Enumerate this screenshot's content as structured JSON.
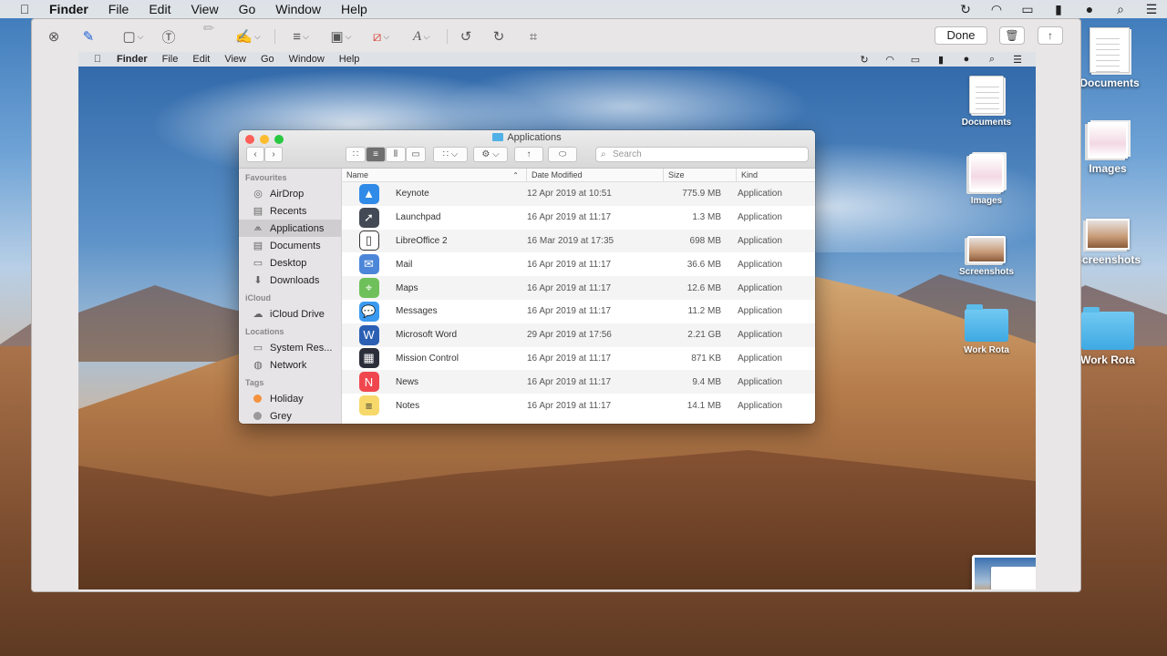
{
  "menubar": {
    "app_name": "Finder",
    "items": [
      "File",
      "Edit",
      "View",
      "Go",
      "Window",
      "Help"
    ],
    "status_icons": [
      "time-machine-icon",
      "wifi-icon",
      "airplay-icon",
      "battery-icon",
      "user-icon",
      "spotlight-icon",
      "notification-center-icon"
    ]
  },
  "markup_toolbar": {
    "done_label": "Done"
  },
  "inner_menubar": {
    "app_name": "Finder",
    "items": [
      "File",
      "Edit",
      "View",
      "Go",
      "Window",
      "Help"
    ]
  },
  "inner_desktop_icons": [
    {
      "label": "Documents"
    },
    {
      "label": "Images"
    },
    {
      "label": "Screenshots"
    },
    {
      "label": "Work Rota"
    }
  ],
  "outer_desktop_icons": [
    {
      "label": "Documents"
    },
    {
      "label": "Images"
    },
    {
      "label": "Screenshots"
    },
    {
      "label": "Work Rota"
    }
  ],
  "finder": {
    "title": "Applications",
    "search_placeholder": "Search",
    "sidebar": {
      "favourites_heading": "Favourites",
      "favourites": [
        {
          "label": "AirDrop",
          "icon": "airdrop-icon"
        },
        {
          "label": "Recents",
          "icon": "recents-icon"
        },
        {
          "label": "Applications",
          "icon": "applications-icon",
          "selected": true
        },
        {
          "label": "Documents",
          "icon": "documents-icon"
        },
        {
          "label": "Desktop",
          "icon": "desktop-icon"
        },
        {
          "label": "Downloads",
          "icon": "downloads-icon"
        }
      ],
      "icloud_heading": "iCloud",
      "icloud": [
        {
          "label": "iCloud Drive",
          "icon": "cloud-icon"
        }
      ],
      "locations_heading": "Locations",
      "locations": [
        {
          "label": "System Res...",
          "icon": "disk-icon"
        },
        {
          "label": "Network",
          "icon": "globe-icon"
        }
      ],
      "tags_heading": "Tags",
      "tags": [
        {
          "label": "Holiday",
          "color": "#f5923e"
        },
        {
          "label": "Grey",
          "color": "#9a9a9a"
        }
      ]
    },
    "columns": {
      "name": "Name",
      "date": "Date Modified",
      "size": "Size",
      "kind": "Kind"
    },
    "rows": [
      {
        "name": "Keynote",
        "date": "12 Apr 2019 at 10:51",
        "size": "775.9 MB",
        "kind": "Application",
        "icon": "keynote-icon",
        "color": "#2f8ae8",
        "glyph": "▲"
      },
      {
        "name": "Launchpad",
        "date": "16 Apr 2019 at 11:17",
        "size": "1.3 MB",
        "kind": "Application",
        "icon": "launchpad-icon",
        "color": "#444a55",
        "glyph": "➚"
      },
      {
        "name": "LibreOffice 2",
        "date": "16 Mar 2019 at 17:35",
        "size": "698 MB",
        "kind": "Application",
        "icon": "libreoffice-icon",
        "color": "#ffffff",
        "glyph": "▯"
      },
      {
        "name": "Mail",
        "date": "16 Apr 2019 at 11:17",
        "size": "36.6 MB",
        "kind": "Application",
        "icon": "mail-icon",
        "color": "#4b86d8",
        "glyph": "✉"
      },
      {
        "name": "Maps",
        "date": "16 Apr 2019 at 11:17",
        "size": "12.6 MB",
        "kind": "Application",
        "icon": "maps-icon",
        "color": "#6fc05a",
        "glyph": "⌖"
      },
      {
        "name": "Messages",
        "date": "16 Apr 2019 at 11:17",
        "size": "11.2 MB",
        "kind": "Application",
        "icon": "messages-icon",
        "color": "#3a9af0",
        "glyph": "💬"
      },
      {
        "name": "Microsoft Word",
        "date": "29 Apr 2019 at 17:56",
        "size": "2.21 GB",
        "kind": "Application",
        "icon": "word-icon",
        "color": "#2b5fb4",
        "glyph": "W"
      },
      {
        "name": "Mission Control",
        "date": "16 Apr 2019 at 11:17",
        "size": "871 KB",
        "kind": "Application",
        "icon": "mission-control-icon",
        "color": "#2b2f3a",
        "glyph": "▦"
      },
      {
        "name": "News",
        "date": "16 Apr 2019 at 11:17",
        "size": "9.4 MB",
        "kind": "Application",
        "icon": "news-icon",
        "color": "#f0474f",
        "glyph": "N"
      },
      {
        "name": "Notes",
        "date": "16 Apr 2019 at 11:17",
        "size": "14.1 MB",
        "kind": "Application",
        "icon": "notes-icon",
        "color": "#f6d96a",
        "glyph": "≡"
      }
    ]
  }
}
